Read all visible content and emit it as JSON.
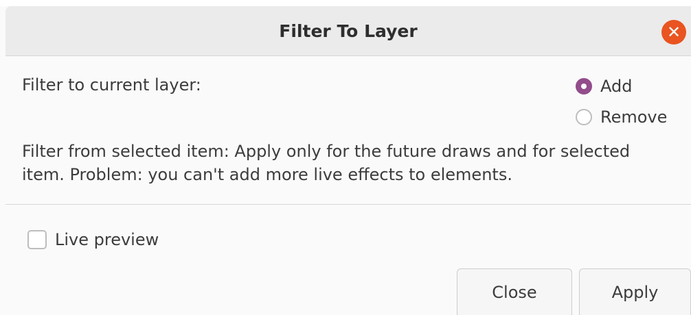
{
  "window": {
    "title": "Filter To Layer",
    "close_glyph": "✕"
  },
  "filter_current": {
    "label": "Filter to current layer:",
    "options": [
      {
        "label": "Add",
        "selected": true
      },
      {
        "label": "Remove",
        "selected": false
      }
    ]
  },
  "description": "Filter from selected item: Apply only for the future draws and for selected item. Problem: you can't add more live effects to elements.",
  "live_preview": {
    "label": "Live preview",
    "checked": false
  },
  "buttons": {
    "close_label": "Close",
    "apply_label": "Apply"
  },
  "colors": {
    "accent": "#924d8b",
    "close_button": "#e95420"
  }
}
